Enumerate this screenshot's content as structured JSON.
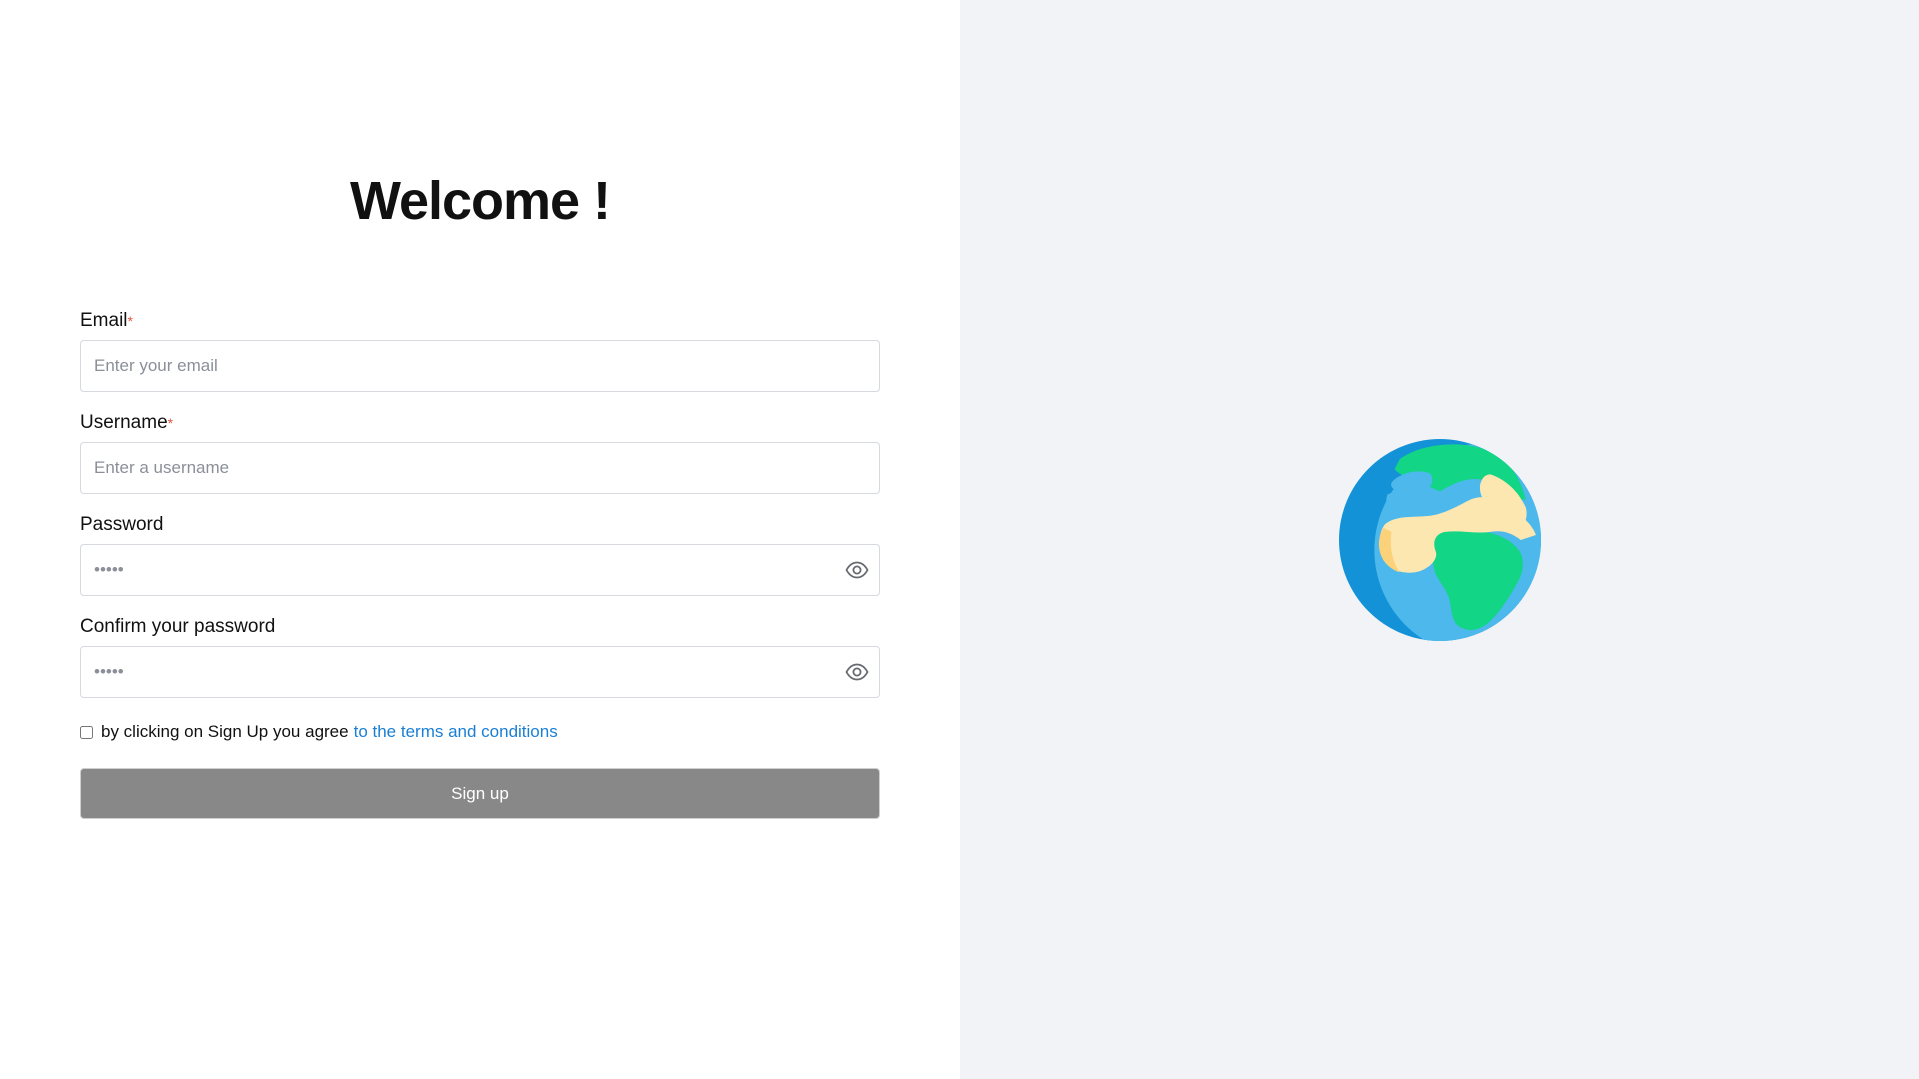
{
  "welcome": {
    "title": "Welcome !"
  },
  "form": {
    "email": {
      "label": "Email",
      "required_mark": "*",
      "placeholder": "Enter your email"
    },
    "username": {
      "label": "Username",
      "required_mark": "*",
      "placeholder": "Enter a username"
    },
    "password": {
      "label": "Password",
      "placeholder": "•••••"
    },
    "confirm_password": {
      "label": "Confirm your password",
      "placeholder": "•••••"
    },
    "terms": {
      "text": "by clicking on Sign Up you agree",
      "link_text": "to the terms and conditions"
    },
    "submit_label": "Sign up"
  },
  "icons": {
    "password_toggle": "eye-icon",
    "illustration": "globe-icon"
  },
  "colors": {
    "link": "#1a7fd4",
    "button_bg": "#888888",
    "right_panel_bg": "#f2f3f6",
    "required": "#e0533d"
  }
}
